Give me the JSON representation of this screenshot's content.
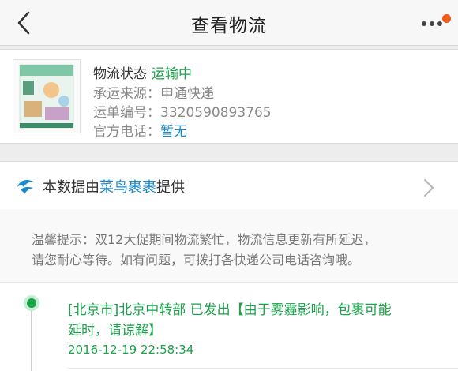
{
  "nav": {
    "title": "查看物流"
  },
  "shipment": {
    "status_label": "物流状态",
    "status_value": "运输中",
    "carrier_label": "承运来源：",
    "carrier_value": "申通快递",
    "tracking_label": "运单编号：",
    "tracking_value": "3320590893765",
    "phone_label": "官方电话：",
    "phone_value": "暂无"
  },
  "provider": {
    "prefix": "本数据由",
    "name": "菜鸟裹裹",
    "suffix": "提供"
  },
  "tips": {
    "line1": "温馨提示：双12大促期间物流繁忙，物流信息更新有所延迟，",
    "line2": "请您耐心等待。如有问题，可拨打各快递公司电话咨询哦。"
  },
  "timeline": [
    {
      "line1": "[北京市]北京中转部 已发出【由于雾霾影响，包裹可能",
      "line2": "延时，请谅解】",
      "time": "2016-12-19 22:58:34"
    }
  ],
  "colors": {
    "accent_green": "#1aa34a",
    "link_blue": "#1a88c9",
    "badge_orange": "#f05a1a"
  }
}
